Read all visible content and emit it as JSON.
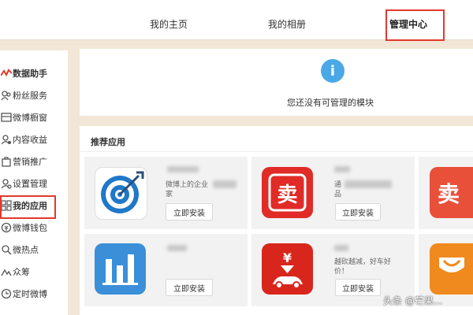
{
  "header": {
    "tabs": [
      {
        "label": "我的主页"
      },
      {
        "label": "我的相册"
      },
      {
        "label": "管理中心"
      }
    ]
  },
  "sidebar": {
    "items": [
      {
        "label": "数据助手",
        "icon": "chart-icon"
      },
      {
        "label": "粉丝服务",
        "icon": "users-icon"
      },
      {
        "label": "微博橱窗",
        "icon": "shop-window-icon"
      },
      {
        "label": "内容收益",
        "icon": "user-coin-icon"
      },
      {
        "label": "营销推广",
        "icon": "bag-icon"
      },
      {
        "label": "设置管理",
        "icon": "user-gear-icon"
      },
      {
        "label": "我的应用",
        "icon": "grid-icon"
      },
      {
        "label": "微博钱包",
        "icon": "wallet-icon"
      },
      {
        "label": "微热点",
        "icon": "hotspot-icon"
      },
      {
        "label": "众筹",
        "icon": "crowdfund-icon"
      },
      {
        "label": "定时微博",
        "icon": "clock-icon"
      }
    ]
  },
  "notice": {
    "text": "您还没有可管理的模块"
  },
  "recommended": {
    "title": "推荐应用",
    "apps": [
      {
        "desc_line1": "微博上的企业",
        "desc_line2": "家",
        "install": "立即安装",
        "icon": "target-icon"
      },
      {
        "desc_line1": "通",
        "desc_line2": "品",
        "install": "立即安装",
        "icon": "sell-icon"
      },
      {
        "desc_line1": "",
        "desc_line2": "",
        "install": "",
        "icon": "sell-icon"
      },
      {
        "desc_line1": "",
        "desc_line2": "",
        "install": "立即安装",
        "icon": "bar-chart-icon"
      },
      {
        "desc_line1": "越砍越减，好车好",
        "desc_line2": "价！",
        "install": "立即安装",
        "icon": "car-price-icon"
      },
      {
        "desc_line1": "",
        "desc_line2": "",
        "install": "",
        "icon": "shopping-icon"
      }
    ]
  },
  "colors": {
    "accent": "#e03a2d",
    "info": "#4aa8e6",
    "background": "#f2e7d6"
  },
  "watermark": "头条 @芒果..."
}
